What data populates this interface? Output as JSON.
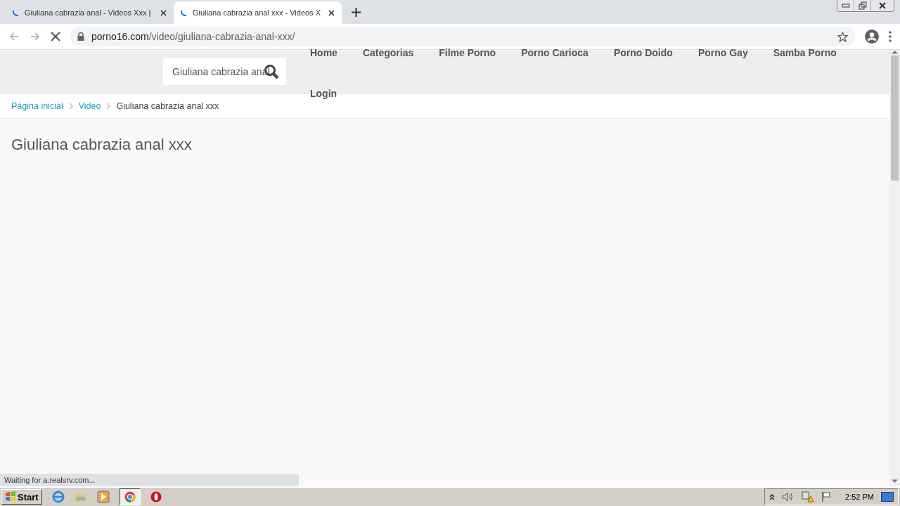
{
  "browser": {
    "tabs": [
      {
        "title": "Giuliana cabrazia anal - Videos Xxx |",
        "selected": false
      },
      {
        "title": "Giuliana cabrazia anal xxx - Videos X",
        "selected": true
      }
    ],
    "address": {
      "domain": "porno16.com",
      "path": "/video/giuliana-cabrazia-anal-xxx/"
    }
  },
  "site": {
    "search": {
      "value": "Giuliana cabrazia anal"
    },
    "nav": [
      "Home",
      "Categorias",
      "Filme Porno",
      "Porno Carioca",
      "Porno Doido",
      "Porno Gay",
      "Samba Porno",
      "Login"
    ],
    "breadcrumbs": [
      {
        "label": "Página inicial",
        "kind": "link"
      },
      {
        "label": "Video",
        "kind": "link"
      },
      {
        "label": "Giuliana cabrazia anal xxx",
        "kind": "current"
      }
    ],
    "title": "Giuliana cabrazia anal xxx"
  },
  "status_text": "Waiting for a.realsrv.com...",
  "taskbar": {
    "start": "Start",
    "clock": "2:52 PM"
  }
}
